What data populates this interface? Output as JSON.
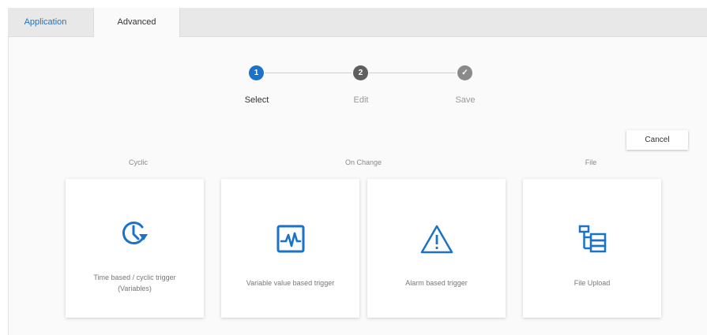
{
  "tabs": [
    {
      "label": "Application"
    },
    {
      "label": "Advanced"
    }
  ],
  "stepper": {
    "steps": [
      {
        "number": "1",
        "label": "Select",
        "state": "active",
        "color": "#1a73c8"
      },
      {
        "number": "2",
        "label": "Edit",
        "state": "pending",
        "color": "#5f5f5f"
      },
      {
        "number": "✓",
        "label": "Save",
        "state": "pending",
        "color": "#8a8a8a"
      }
    ]
  },
  "cancel_label": "Cancel",
  "sections": {
    "cyclic": "Cyclic",
    "on_change": "On Change",
    "file": "File"
  },
  "cards": [
    {
      "icon": "clock-cycle-icon",
      "line1": "Time based / cyclic trigger",
      "line2": "(Variables)"
    },
    {
      "icon": "trend-monitor-icon",
      "line1": "Variable value based trigger",
      "line2": ""
    },
    {
      "icon": "warning-triangle-icon",
      "line1": "Alarm based trigger",
      "line2": ""
    },
    {
      "icon": "file-tree-icon",
      "line1": "File Upload",
      "line2": ""
    }
  ],
  "colors": {
    "accent": "#1a73c8",
    "tabbar": "#e8e8e8",
    "content_bg": "#fafafa"
  }
}
